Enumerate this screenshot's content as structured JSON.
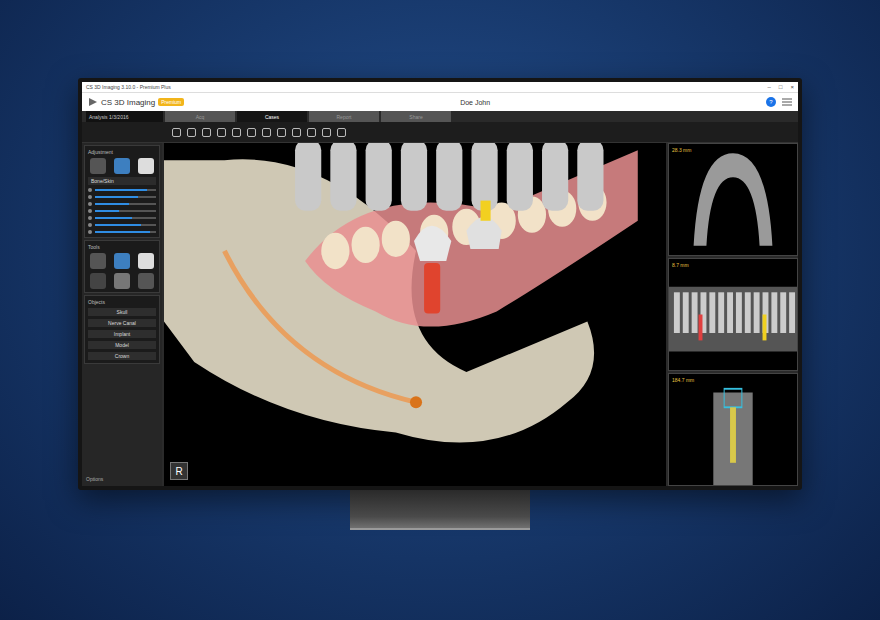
{
  "window": {
    "title": "CS 3D Imaging 3.10.0 - Premium Plus",
    "controls": [
      "–",
      "□",
      "×"
    ]
  },
  "header": {
    "logo": "CS 3D Imaging",
    "badge": "Premium",
    "patient": "Doe John",
    "notification": "?"
  },
  "tabs": [
    {
      "label": "Acq",
      "selected": false
    },
    {
      "label": "Cases",
      "selected": true
    },
    {
      "label": "Report",
      "selected": false
    },
    {
      "label": "Share",
      "selected": false
    }
  ],
  "analysis": "Analysis 1/3/2016",
  "left_panel": {
    "sections": [
      "Adjustment",
      "Tools",
      "Objects"
    ],
    "preset": "Bone/Skin",
    "sliders": [
      {
        "level": 0.85
      },
      {
        "level": 0.7
      },
      {
        "level": 0.55
      },
      {
        "level": 0.4
      },
      {
        "level": 0.6
      },
      {
        "level": 0.75
      },
      {
        "level": 0.9
      }
    ],
    "objects": [
      "Skull",
      "Nerve Canal",
      "Implant",
      "Model",
      "Crown"
    ],
    "footer": "Options"
  },
  "views": [
    {
      "name": "axial",
      "reading": "28.3 mm"
    },
    {
      "name": "panoramic",
      "reading": "8.7 mm"
    },
    {
      "name": "cross-section",
      "reading": "184.7 mm"
    }
  ],
  "orientation": "R"
}
